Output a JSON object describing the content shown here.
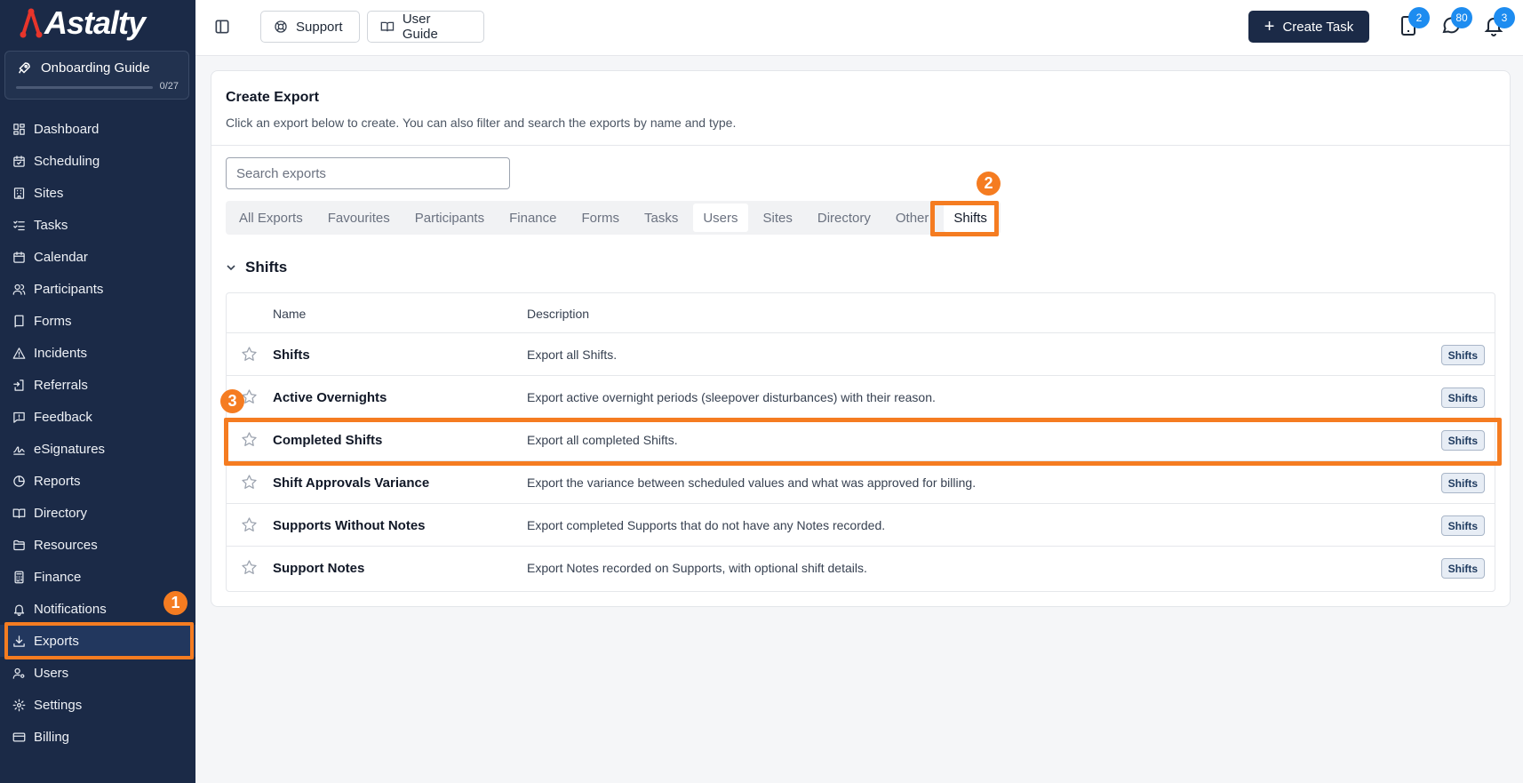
{
  "brand": {
    "name": "Astalty"
  },
  "onboarding": {
    "title": "Onboarding Guide",
    "progress_text": "0/27",
    "progress_fraction": 0.0
  },
  "sidebar": {
    "items": [
      {
        "label": "Dashboard",
        "icon": "dashboard-icon"
      },
      {
        "label": "Scheduling",
        "icon": "calendar-check-icon"
      },
      {
        "label": "Sites",
        "icon": "building-icon"
      },
      {
        "label": "Tasks",
        "icon": "list-check-icon"
      },
      {
        "label": "Calendar",
        "icon": "calendar-icon"
      },
      {
        "label": "Participants",
        "icon": "users-icon"
      },
      {
        "label": "Forms",
        "icon": "book-icon"
      },
      {
        "label": "Incidents",
        "icon": "warning-icon"
      },
      {
        "label": "Referrals",
        "icon": "referral-icon"
      },
      {
        "label": "Feedback",
        "icon": "message-square-icon"
      },
      {
        "label": "eSignatures",
        "icon": "signature-icon"
      },
      {
        "label": "Reports",
        "icon": "pie-chart-icon"
      },
      {
        "label": "Directory",
        "icon": "open-book-icon"
      },
      {
        "label": "Resources",
        "icon": "folder-icon"
      },
      {
        "label": "Finance",
        "icon": "calculator-icon"
      },
      {
        "label": "Notifications",
        "icon": "bell-icon"
      },
      {
        "label": "Exports",
        "icon": "download-icon",
        "active": true
      },
      {
        "label": "Users",
        "icon": "user-cog-icon"
      },
      {
        "label": "Settings",
        "icon": "gear-icon"
      },
      {
        "label": "Billing",
        "icon": "credit-card-icon"
      }
    ]
  },
  "topbar": {
    "support_label": "Support",
    "user_guide_label": "User Guide",
    "create_task_label": "Create Task",
    "badges": {
      "tablet": "2",
      "messages": "80",
      "notifications": "3"
    }
  },
  "export_page": {
    "title": "Create Export",
    "description": "Click an export below to create. You can also filter and search the exports by name and type.",
    "search_placeholder": "Search exports",
    "tabs": [
      "All Exports",
      "Favourites",
      "Participants",
      "Finance",
      "Forms",
      "Tasks",
      "Users",
      "Sites",
      "Directory",
      "Other",
      "Shifts"
    ],
    "active_tab": "Shifts",
    "section_title": "Shifts",
    "columns": {
      "name": "Name",
      "description": "Description"
    },
    "rows": [
      {
        "name": "Shifts",
        "description": "Export all Shifts.",
        "tag": "Shifts"
      },
      {
        "name": "Active Overnights",
        "description": "Export active overnight periods (sleepover disturbances) with their reason.",
        "tag": "Shifts"
      },
      {
        "name": "Completed Shifts",
        "description": "Export all completed Shifts.",
        "tag": "Shifts"
      },
      {
        "name": "Shift Approvals Variance",
        "description": "Export the variance between scheduled values and what was approved for billing.",
        "tag": "Shifts"
      },
      {
        "name": "Supports Without Notes",
        "description": "Export completed Supports that do not have any Notes recorded.",
        "tag": "Shifts"
      },
      {
        "name": "Support Notes",
        "description": "Export Notes recorded on Supports, with optional shift details.",
        "tag": "Shifts"
      }
    ]
  },
  "annotations": {
    "step1": "1",
    "step2": "2",
    "step3": "3"
  },
  "colors": {
    "sidebar_bg": "#1b2a47",
    "highlight": "#f57c21",
    "badge": "#1d8cf0"
  }
}
